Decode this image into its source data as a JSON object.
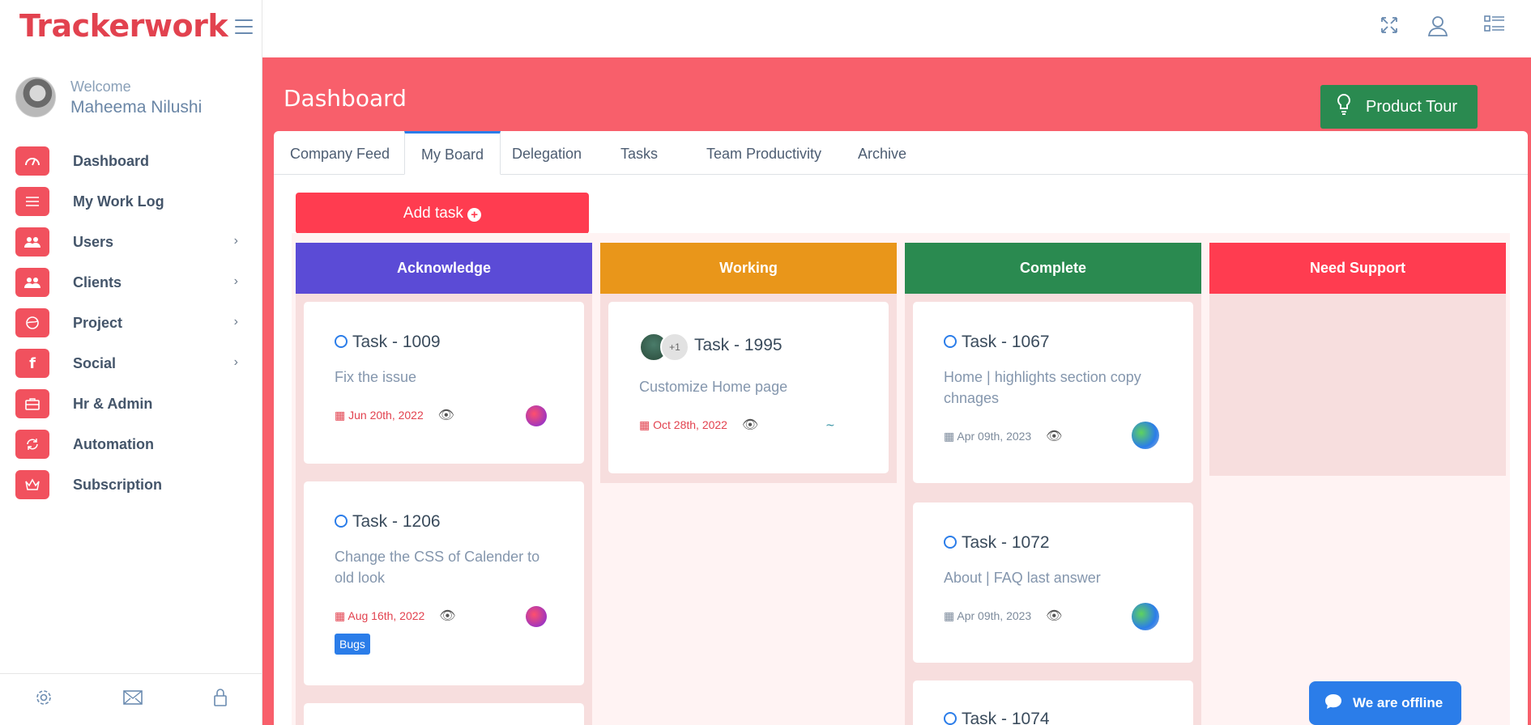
{
  "app": {
    "brand": "Trackerwork"
  },
  "user": {
    "welcome": "Welcome",
    "name": "Maheema Nilushi"
  },
  "sidebar": {
    "items": [
      {
        "label": "Dashboard",
        "icon": "speedometer-icon",
        "has_submenu": false
      },
      {
        "label": "My Work Log",
        "icon": "list-icon",
        "has_submenu": false
      },
      {
        "label": "Users",
        "icon": "users-icon",
        "has_submenu": true
      },
      {
        "label": "Clients",
        "icon": "users-icon",
        "has_submenu": true
      },
      {
        "label": "Project",
        "icon": "globe-icon",
        "has_submenu": true
      },
      {
        "label": "Social",
        "icon": "facebook-icon",
        "has_submenu": true
      },
      {
        "label": "Hr & Admin",
        "icon": "briefcase-icon",
        "has_submenu": false
      },
      {
        "label": "Automation",
        "icon": "refresh-icon",
        "has_submenu": false
      },
      {
        "label": "Subscription",
        "icon": "crown-icon",
        "has_submenu": false
      }
    ],
    "footer_icons": [
      "gear-icon",
      "mail-icon",
      "lock-icon"
    ]
  },
  "topbar": {
    "icons": [
      "fullscreen-icon",
      "user-icon",
      "list-settings-icon"
    ]
  },
  "page": {
    "title": "Dashboard",
    "tour_button": "Product Tour"
  },
  "tabs": [
    {
      "label": "Company Feed",
      "active": false
    },
    {
      "label": "My Board",
      "active": true
    },
    {
      "label": "Delegation",
      "active": false
    },
    {
      "label": "Tasks",
      "active": false
    },
    {
      "label": "Team Productivity",
      "active": false
    },
    {
      "label": "Archive",
      "active": false
    }
  ],
  "add_task": {
    "label": "Add task"
  },
  "columns": [
    {
      "title": "Acknowledge",
      "color": "#5b4bd6",
      "cards": [
        {
          "title": "Task - 1009",
          "desc": "Fix the issue",
          "date": "Jun 20th, 2022",
          "date_color": "red",
          "badge": ""
        },
        {
          "title": "Task - 1206",
          "desc": "Change the CSS of Calender to old look",
          "date": "Aug 16th, 2022",
          "date_color": "red",
          "badge": "Bugs"
        }
      ]
    },
    {
      "title": "Working",
      "color": "#e9961a",
      "cards": [
        {
          "title": "Task - 1995",
          "desc": "Customize Home page",
          "date": "Oct 28th, 2022",
          "date_color": "red",
          "assignee_extra": "+1"
        }
      ]
    },
    {
      "title": "Complete",
      "color": "#2a8a50",
      "cards": [
        {
          "title": "Task - 1067",
          "desc": "Home | highlights section copy chnages",
          "date": "Apr 09th, 2023",
          "date_color": "gray"
        },
        {
          "title": "Task - 1072",
          "desc": "About | FAQ last answer",
          "date": "Apr 09th, 2023",
          "date_color": "gray"
        },
        {
          "title": "Task - 1074"
        }
      ]
    },
    {
      "title": "Need Support",
      "color": "#ff3c50",
      "cards": []
    }
  ],
  "chat": {
    "label": "We are offline"
  }
}
